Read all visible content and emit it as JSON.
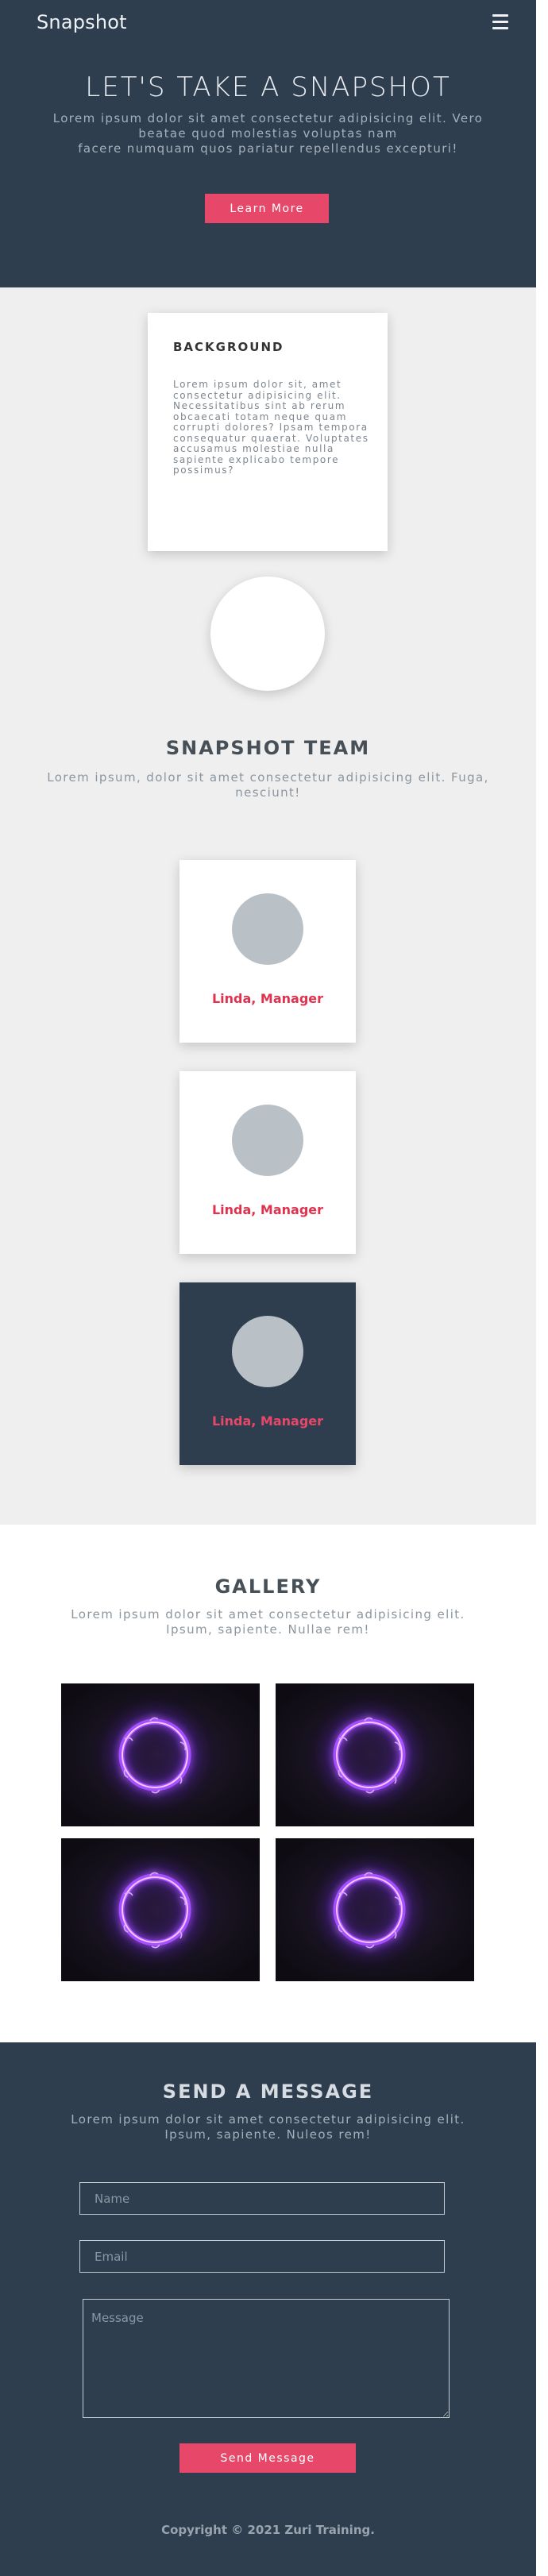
{
  "header": {
    "brand": "Snapshot",
    "menu_icon": "hamburger-menu-icon"
  },
  "hero": {
    "title": "LET'S TAKE A SNAPSHOT",
    "subtitle_line1": "Lorem ipsum dolor sit amet consectetur adipisicing elit. Vero beatae quod molestias voluptas nam",
    "subtitle_line2": "facere numquam quos pariatur repellendus excepturi!",
    "cta_label": "Learn More"
  },
  "background": {
    "heading": "BACKGROUND",
    "body": "Lorem ipsum dolor sit, amet consectetur adipisicing elit. Necessitatibus sint ab rerum obcaecati totam neque quam corrupti dolores? Ipsam tempora consequatur quaerat. Voluptates accusamus molestiae nulla sapiente explicabo tempore possimus?"
  },
  "team": {
    "title": "SNAPSHOT TEAM",
    "subtitle": "Lorem ipsum, dolor sit amet consectetur adipisicing elit. Fuga, nesciunt!",
    "members": [
      {
        "name": "Linda, Manager"
      },
      {
        "name": "Linda, Manager"
      },
      {
        "name": "Linda, Manager"
      }
    ]
  },
  "gallery": {
    "title": "GALLERY",
    "subtitle": "Lorem ipsum dolor sit amet consectetur adipisicing elit. Ipsum, sapiente. Nullae rem!",
    "image_icon": "glowing-ring-image"
  },
  "contact": {
    "title": "SEND A MESSAGE",
    "subtitle": "Lorem ipsum dolor sit amet consectetur adipisicing elit. Ipsum, sapiente. Nuleos rem!",
    "name_placeholder": "Name",
    "email_placeholder": "Email",
    "message_placeholder": "Message",
    "submit_label": "Send Message"
  },
  "footer": {
    "copyright": "Copyright © 2021 Zuri Training."
  },
  "colors": {
    "dark": "#2e3e4f",
    "accent": "#e7486a",
    "light_bg": "#efefef"
  }
}
